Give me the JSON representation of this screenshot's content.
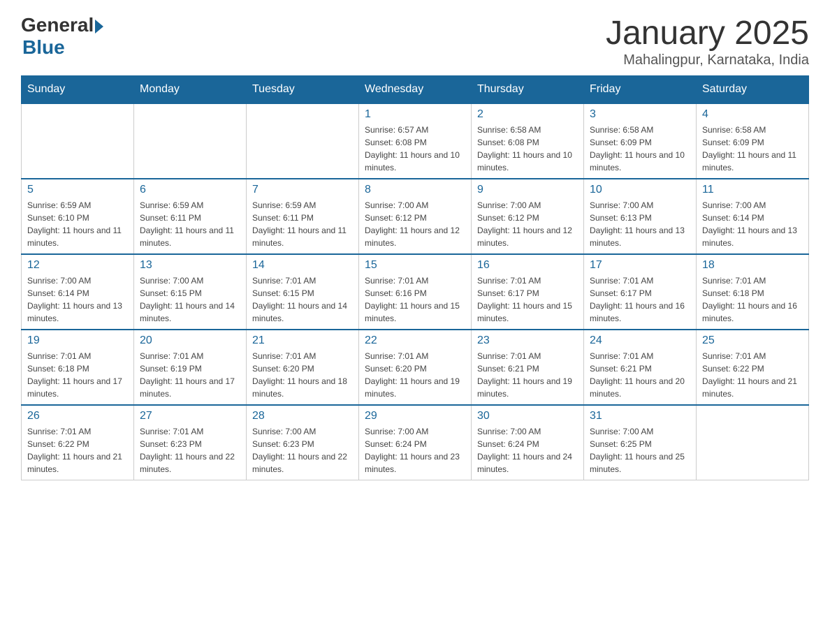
{
  "header": {
    "logo_general": "General",
    "logo_blue": "Blue",
    "title": "January 2025",
    "subtitle": "Mahalingpur, Karnataka, India"
  },
  "days_of_week": [
    "Sunday",
    "Monday",
    "Tuesday",
    "Wednesday",
    "Thursday",
    "Friday",
    "Saturday"
  ],
  "weeks": [
    [
      {
        "day": "",
        "info": ""
      },
      {
        "day": "",
        "info": ""
      },
      {
        "day": "",
        "info": ""
      },
      {
        "day": "1",
        "info": "Sunrise: 6:57 AM\nSunset: 6:08 PM\nDaylight: 11 hours and 10 minutes."
      },
      {
        "day": "2",
        "info": "Sunrise: 6:58 AM\nSunset: 6:08 PM\nDaylight: 11 hours and 10 minutes."
      },
      {
        "day": "3",
        "info": "Sunrise: 6:58 AM\nSunset: 6:09 PM\nDaylight: 11 hours and 10 minutes."
      },
      {
        "day": "4",
        "info": "Sunrise: 6:58 AM\nSunset: 6:09 PM\nDaylight: 11 hours and 11 minutes."
      }
    ],
    [
      {
        "day": "5",
        "info": "Sunrise: 6:59 AM\nSunset: 6:10 PM\nDaylight: 11 hours and 11 minutes."
      },
      {
        "day": "6",
        "info": "Sunrise: 6:59 AM\nSunset: 6:11 PM\nDaylight: 11 hours and 11 minutes."
      },
      {
        "day": "7",
        "info": "Sunrise: 6:59 AM\nSunset: 6:11 PM\nDaylight: 11 hours and 11 minutes."
      },
      {
        "day": "8",
        "info": "Sunrise: 7:00 AM\nSunset: 6:12 PM\nDaylight: 11 hours and 12 minutes."
      },
      {
        "day": "9",
        "info": "Sunrise: 7:00 AM\nSunset: 6:12 PM\nDaylight: 11 hours and 12 minutes."
      },
      {
        "day": "10",
        "info": "Sunrise: 7:00 AM\nSunset: 6:13 PM\nDaylight: 11 hours and 13 minutes."
      },
      {
        "day": "11",
        "info": "Sunrise: 7:00 AM\nSunset: 6:14 PM\nDaylight: 11 hours and 13 minutes."
      }
    ],
    [
      {
        "day": "12",
        "info": "Sunrise: 7:00 AM\nSunset: 6:14 PM\nDaylight: 11 hours and 13 minutes."
      },
      {
        "day": "13",
        "info": "Sunrise: 7:00 AM\nSunset: 6:15 PM\nDaylight: 11 hours and 14 minutes."
      },
      {
        "day": "14",
        "info": "Sunrise: 7:01 AM\nSunset: 6:15 PM\nDaylight: 11 hours and 14 minutes."
      },
      {
        "day": "15",
        "info": "Sunrise: 7:01 AM\nSunset: 6:16 PM\nDaylight: 11 hours and 15 minutes."
      },
      {
        "day": "16",
        "info": "Sunrise: 7:01 AM\nSunset: 6:17 PM\nDaylight: 11 hours and 15 minutes."
      },
      {
        "day": "17",
        "info": "Sunrise: 7:01 AM\nSunset: 6:17 PM\nDaylight: 11 hours and 16 minutes."
      },
      {
        "day": "18",
        "info": "Sunrise: 7:01 AM\nSunset: 6:18 PM\nDaylight: 11 hours and 16 minutes."
      }
    ],
    [
      {
        "day": "19",
        "info": "Sunrise: 7:01 AM\nSunset: 6:18 PM\nDaylight: 11 hours and 17 minutes."
      },
      {
        "day": "20",
        "info": "Sunrise: 7:01 AM\nSunset: 6:19 PM\nDaylight: 11 hours and 17 minutes."
      },
      {
        "day": "21",
        "info": "Sunrise: 7:01 AM\nSunset: 6:20 PM\nDaylight: 11 hours and 18 minutes."
      },
      {
        "day": "22",
        "info": "Sunrise: 7:01 AM\nSunset: 6:20 PM\nDaylight: 11 hours and 19 minutes."
      },
      {
        "day": "23",
        "info": "Sunrise: 7:01 AM\nSunset: 6:21 PM\nDaylight: 11 hours and 19 minutes."
      },
      {
        "day": "24",
        "info": "Sunrise: 7:01 AM\nSunset: 6:21 PM\nDaylight: 11 hours and 20 minutes."
      },
      {
        "day": "25",
        "info": "Sunrise: 7:01 AM\nSunset: 6:22 PM\nDaylight: 11 hours and 21 minutes."
      }
    ],
    [
      {
        "day": "26",
        "info": "Sunrise: 7:01 AM\nSunset: 6:22 PM\nDaylight: 11 hours and 21 minutes."
      },
      {
        "day": "27",
        "info": "Sunrise: 7:01 AM\nSunset: 6:23 PM\nDaylight: 11 hours and 22 minutes."
      },
      {
        "day": "28",
        "info": "Sunrise: 7:00 AM\nSunset: 6:23 PM\nDaylight: 11 hours and 22 minutes."
      },
      {
        "day": "29",
        "info": "Sunrise: 7:00 AM\nSunset: 6:24 PM\nDaylight: 11 hours and 23 minutes."
      },
      {
        "day": "30",
        "info": "Sunrise: 7:00 AM\nSunset: 6:24 PM\nDaylight: 11 hours and 24 minutes."
      },
      {
        "day": "31",
        "info": "Sunrise: 7:00 AM\nSunset: 6:25 PM\nDaylight: 11 hours and 25 minutes."
      },
      {
        "day": "",
        "info": ""
      }
    ]
  ]
}
